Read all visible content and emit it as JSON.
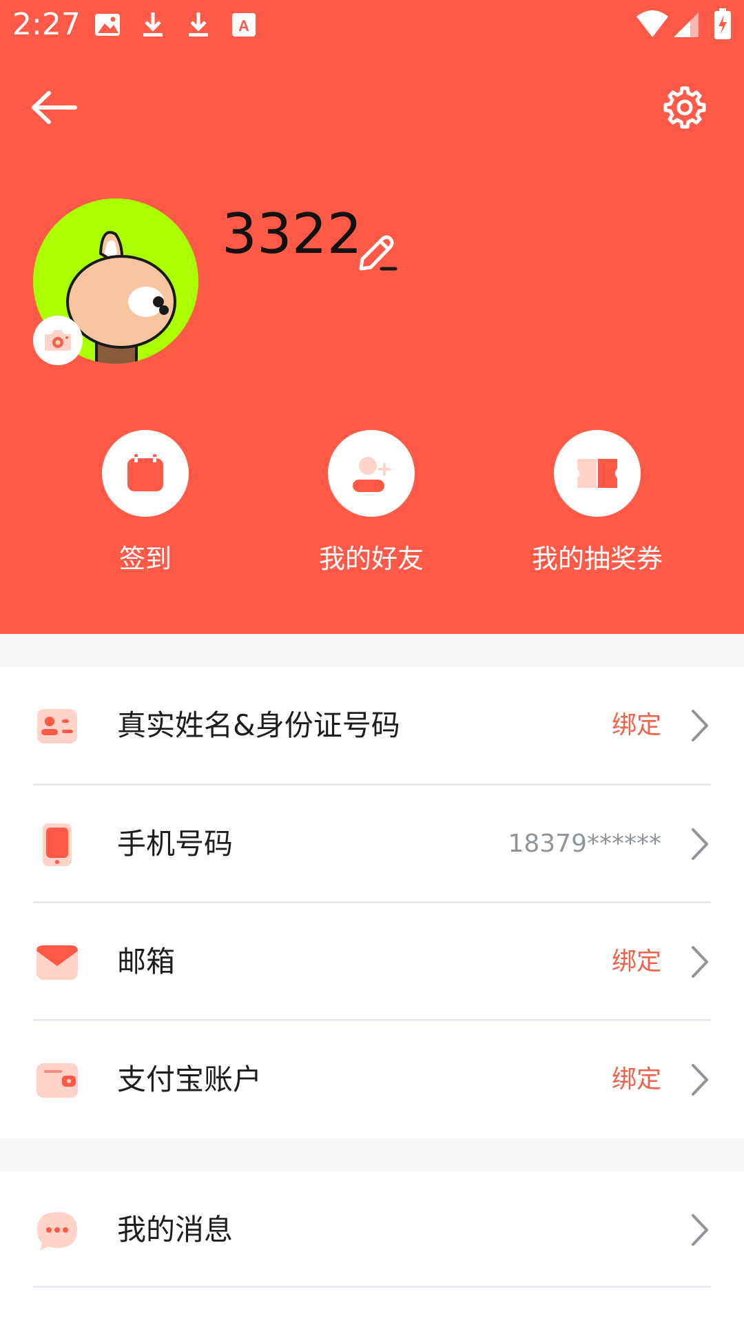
{
  "status_bar": {
    "time": "2:27",
    "icons": [
      "image-icon",
      "download-icon",
      "download-icon",
      "font-icon",
      "wifi-icon",
      "signal-icon",
      "battery-charging-icon"
    ]
  },
  "header": {
    "background_color": "#FF5A47",
    "back_icon": "arrow-left-icon",
    "settings_icon": "gear-icon",
    "username": "3322",
    "edit_icon": "pencil-icon",
    "avatar_bg": "#AAFF00"
  },
  "quick_actions": [
    {
      "label": "签到",
      "icon": "calendar-icon"
    },
    {
      "label": "我的好友",
      "icon": "add-friend-icon"
    },
    {
      "label": "我的抽奖券",
      "icon": "ticket-icon"
    }
  ],
  "account_items": [
    {
      "label": "真实姓名&身份证号码",
      "value": "绑定",
      "icon": "id-card-icon"
    },
    {
      "label": "手机号码",
      "value": "18379******",
      "icon": "phone-icon"
    },
    {
      "label": "邮箱",
      "value": "绑定",
      "icon": "mail-icon"
    },
    {
      "label": "支付宝账户",
      "value": "绑定",
      "icon": "wallet-icon"
    }
  ],
  "message_item": {
    "label": "我的消息",
    "icon": "chat-bubble-icon"
  },
  "colors": {
    "accent": "#FF5A47",
    "bind_text": "#F2624A",
    "muted_text": "#8E9499",
    "icon_light": "#FFD3C7"
  }
}
